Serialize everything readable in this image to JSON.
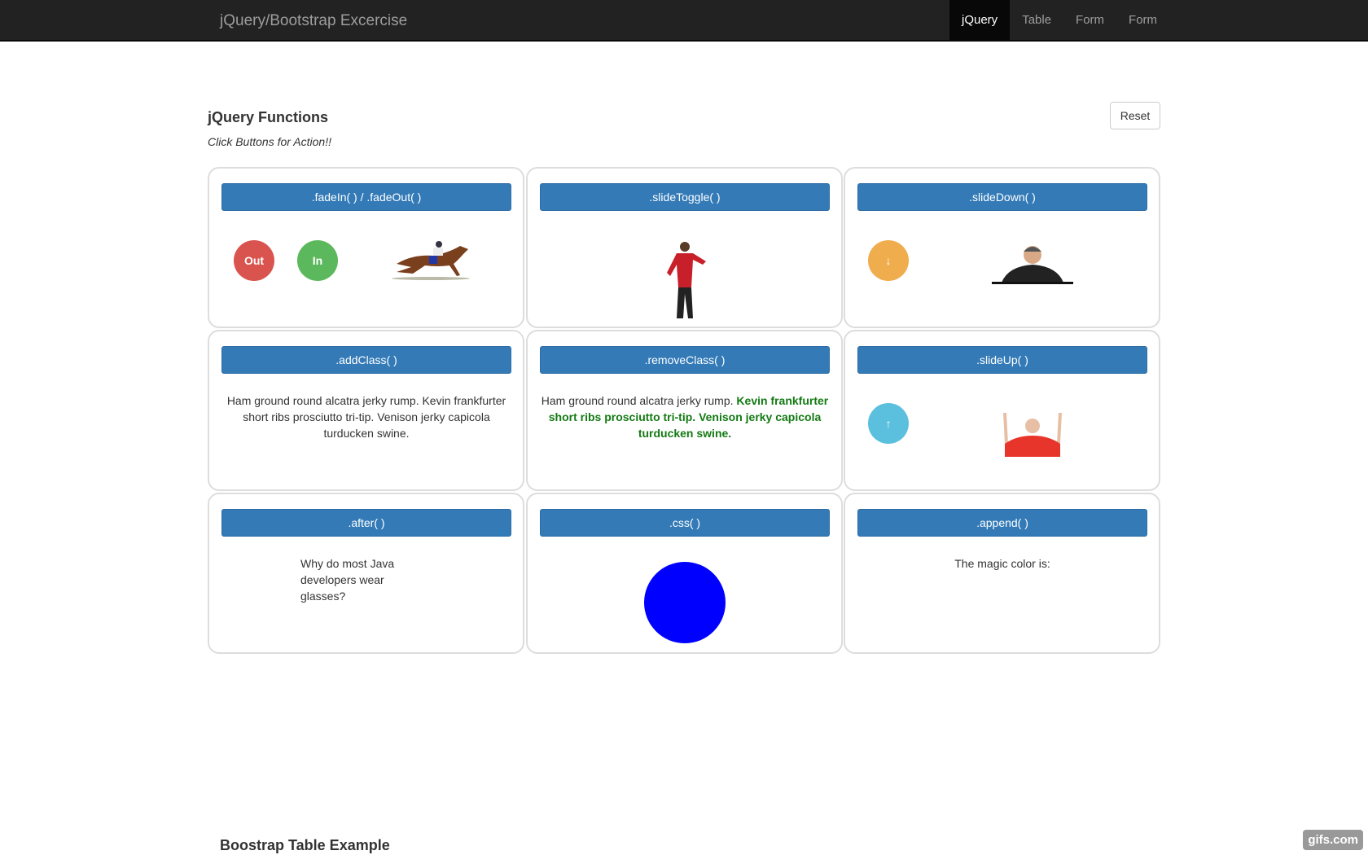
{
  "navbar": {
    "brand": "jQuery/Bootstrap Excercise",
    "links": [
      "jQuery",
      "Table",
      "Form",
      "Form"
    ],
    "active": "jQuery"
  },
  "header": {
    "title": "jQuery Functions",
    "subtitle": "Click Buttons for Action!!",
    "reset_label": "Reset"
  },
  "cards": {
    "fade": {
      "button": ".fadeIn( ) / .fadeOut( )",
      "out_label": "Out",
      "in_label": "In"
    },
    "slideToggle": {
      "button": ".slideToggle( )"
    },
    "slideDown": {
      "button": ".slideDown( )"
    },
    "addClass": {
      "button": ".addClass( )",
      "text": "Ham ground round alcatra jerky rump. Kevin frankfurter short ribs prosciutto tri-tip. Venison jerky capicola turducken swine."
    },
    "removeClass": {
      "button": ".removeClass( )",
      "text_plain": "Ham ground round alcatra jerky rump. ",
      "text_bold": "Kevin frankfurter short ribs prosciutto tri-tip. Venison jerky capicola turducken swine."
    },
    "slideUp": {
      "button": ".slideUp( )"
    },
    "after": {
      "button": ".after( )",
      "text": "Why do most Java developers wear glasses?"
    },
    "css": {
      "button": ".css( )",
      "circle_color": "#0000ff"
    },
    "append": {
      "button": ".append( )",
      "text": "The magic color is:"
    }
  },
  "colors": {
    "primary": "#337ab7",
    "danger": "#d9534f",
    "success": "#5cb85c",
    "warning": "#f0ad4e",
    "info": "#5bc0de"
  },
  "footer_section": {
    "title": "Boostrap Table Example"
  },
  "watermark": "gifs.com"
}
